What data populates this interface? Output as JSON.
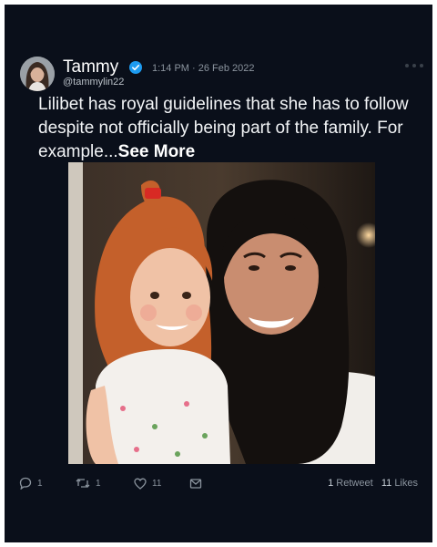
{
  "tweet": {
    "name": "Tammy",
    "handle": "@tammylin22",
    "timestamp": "1:14 PM · 26 Feb 2022",
    "text": "Lilibet has royal guidelines that she has to follow despite not officially being part of the family. For example...",
    "see_more": "See More",
    "verified_icon": "verified-badge-icon",
    "more_icon": "more-options-icon"
  },
  "actions": {
    "reply_count": "1",
    "retweet_count": "1",
    "like_count": "11",
    "reply_icon": "reply-icon",
    "retweet_icon": "retweet-icon",
    "like_icon": "heart-icon",
    "share_icon": "share-icon"
  },
  "stats": {
    "retweets_num": "1",
    "retweets_label": "Retweet",
    "likes_num": "11",
    "likes_label": "Likes"
  },
  "colors": {
    "background": "#0a0f1a",
    "text": "#f2f4f6",
    "muted": "#8b949e",
    "verified": "#1d9bf0"
  }
}
